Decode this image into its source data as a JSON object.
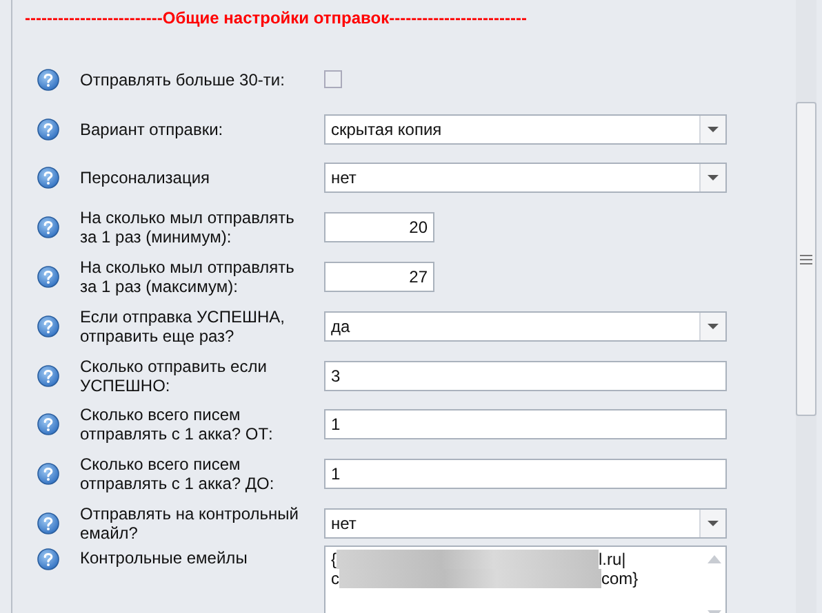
{
  "section_title": "-------------------------Общие настройки отправок-------------------------",
  "settings": [
    {
      "kind": "checkbox",
      "label": "Отправлять больше 30-ти:",
      "checked": false
    },
    {
      "kind": "dropdown",
      "label": "Вариант отправки:",
      "value": "скрытая копия"
    },
    {
      "kind": "dropdown",
      "label": "Персонализация",
      "value": "нет"
    },
    {
      "kind": "number",
      "label": "На сколько мыл отправлять за 1 раз (минимум):",
      "value": "20"
    },
    {
      "kind": "number",
      "label": "На сколько мыл отправлять за 1 раз (максимум):",
      "value": "27"
    },
    {
      "kind": "dropdown",
      "label": "Если отправка УСПЕШНА, отправить еще раз?",
      "value": "да"
    },
    {
      "kind": "text",
      "label": "Сколько отправить если УСПЕШНО:",
      "value": "3"
    },
    {
      "kind": "text",
      "label": "Сколько всего писем отправлять с 1 акка? ОТ:",
      "value": "1"
    },
    {
      "kind": "text",
      "label": "Сколько всего писем отправлять с 1 акка? ДО:",
      "value": "1"
    },
    {
      "kind": "dropdown",
      "label": "Отправлять на контрольный емайл?",
      "value": "нет"
    },
    {
      "kind": "textarea",
      "label": "Контрольные емейлы",
      "lines": [
        {
          "before": "{",
          "after": "l.ru|"
        },
        {
          "before": "c",
          "after": "com}"
        }
      ]
    }
  ]
}
